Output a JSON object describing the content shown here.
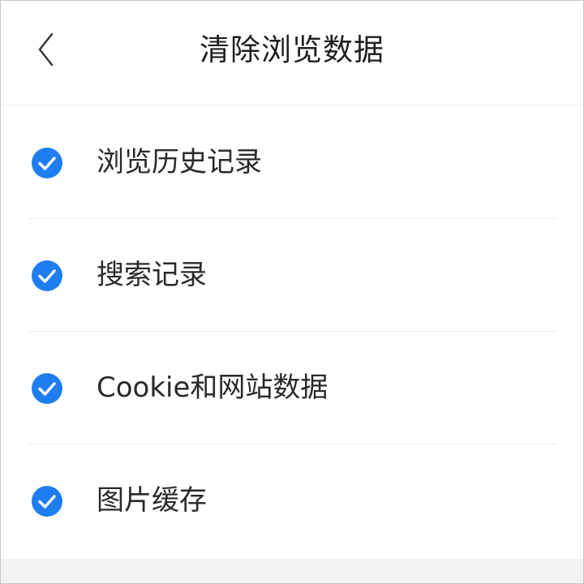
{
  "header": {
    "title": "清除浏览数据",
    "back_icon": "chevron-left-icon"
  },
  "items": [
    {
      "label": "浏览历史记录",
      "checked": true
    },
    {
      "label": "搜索记录",
      "checked": true
    },
    {
      "label": "Cookie和网站数据",
      "checked": true
    },
    {
      "label": "图片缓存",
      "checked": true
    }
  ],
  "colors": {
    "accent": "#1e7ef0",
    "text": "#2a2a2a",
    "divider": "#ececec",
    "footer": "#f2f2f4"
  }
}
